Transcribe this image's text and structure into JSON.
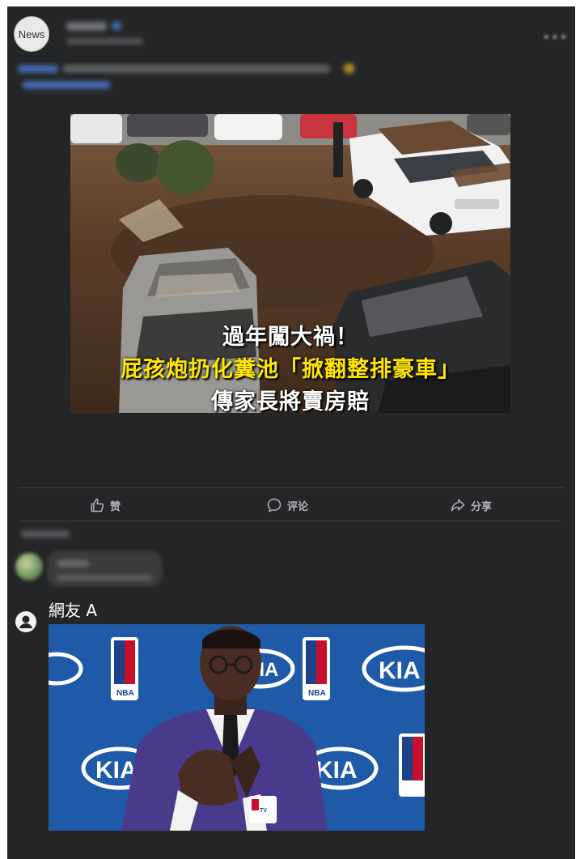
{
  "post": {
    "avatar_text": "News",
    "video_caption_line1": "過年闖大禍！",
    "video_caption_line2": "屁孩炮扔化糞池「掀翻整排豪車」",
    "video_caption_line3": "傳家長將賣房賠"
  },
  "actions": {
    "like_label": "赞",
    "comment_label": "评论",
    "share_label": "分享"
  },
  "comment": {
    "user_name": "網友 A"
  },
  "photo_logos": {
    "sponsor": "KIA",
    "league": "NBA",
    "broadcaster": "NBA TV"
  },
  "colors": {
    "card_bg": "#242526",
    "caption_highlight": "#ffe600",
    "action_text": "#b0b3b8"
  }
}
